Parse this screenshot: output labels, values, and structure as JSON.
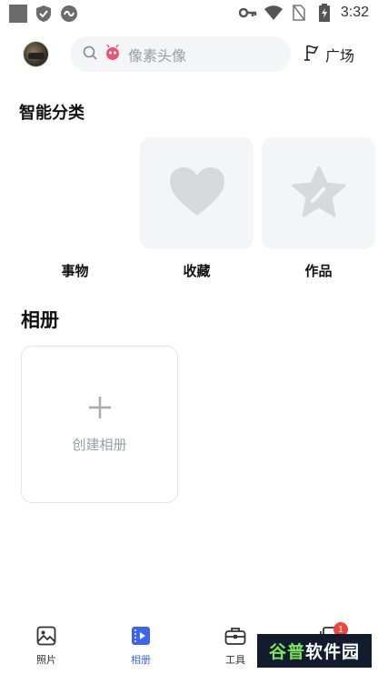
{
  "status_bar": {
    "time": "3:32",
    "icons": [
      "gallery-icon",
      "shield-check-icon",
      "sync-icon",
      "key-icon",
      "wifi-icon",
      "no-sim-icon",
      "battery-charging-icon"
    ]
  },
  "header": {
    "search_placeholder": "像素头像",
    "plaza_label": "广场"
  },
  "smart_categories": {
    "title": "智能分类",
    "items": [
      {
        "label": "事物",
        "icon": "none"
      },
      {
        "label": "收藏",
        "icon": "heart-icon"
      },
      {
        "label": "作品",
        "icon": "star-pen-icon"
      }
    ]
  },
  "albums": {
    "title": "相册",
    "create_label": "创建相册"
  },
  "bottom_nav": {
    "items": [
      {
        "label": "照片",
        "icon": "photo-icon",
        "active": false
      },
      {
        "label": "相册",
        "icon": "album-icon",
        "active": true
      },
      {
        "label": "工具",
        "icon": "toolbox-icon",
        "active": false
      },
      {
        "label": "",
        "icon": "stack-icon",
        "active": false
      }
    ],
    "badge_count": "1"
  },
  "watermark": {
    "text_a": "谷普",
    "text_b": "软件园"
  },
  "colors": {
    "accent": "#3d63f5",
    "card_bg": "#f4f5f7",
    "badge": "#f0453a",
    "placeholder": "#9a9ca3"
  }
}
